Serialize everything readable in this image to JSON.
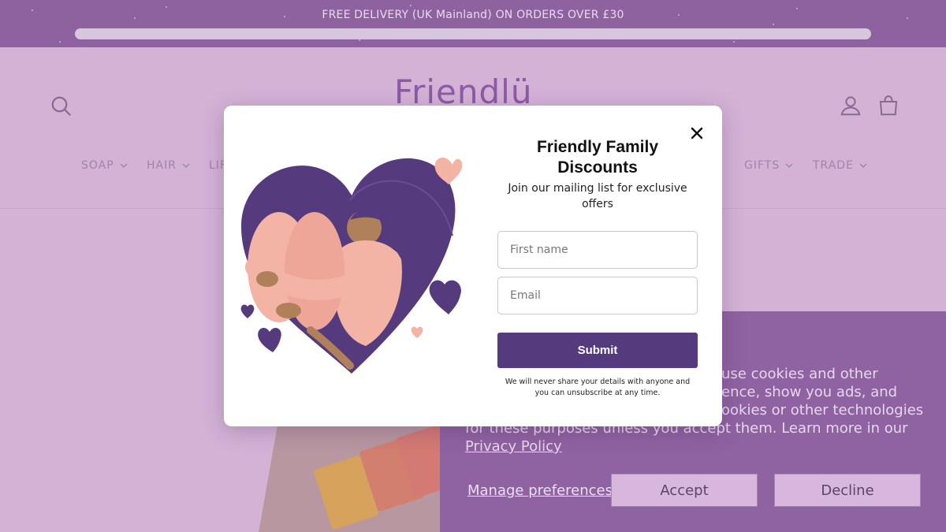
{
  "announcement": {
    "text": "FREE DELIVERY (UK Mainland) ON ORDERS OVER £30"
  },
  "header": {
    "logo_text": "Friendlü",
    "icons": [
      "search-icon",
      "account-icon",
      "cart-icon"
    ],
    "nav": [
      {
        "label": "SOAP"
      },
      {
        "label": "HAIR"
      },
      {
        "label": "LIF"
      },
      {
        "label": "GIFTS"
      },
      {
        "label": "TRADE"
      }
    ]
  },
  "modal": {
    "title": "Friendly Family Discounts",
    "subtitle": "Join our mailing list for exclusive offers",
    "first_name_placeholder": "First name",
    "email_placeholder": "Email",
    "submit_label": "Submit",
    "note": "We will never share your details with anyone and you can unsubscribe at any time."
  },
  "cookie_banner": {
    "text_line1": "use cookies and other",
    "text_line2": "ence, show you ads, and",
    "text_line3": "ookies or other technologies",
    "text_line4": "for these purposes unless you accept them. Learn more in our",
    "privacy_link": "Privacy Policy",
    "manage_label": "Manage preferences",
    "accept_label": "Accept",
    "decline_label": "Decline"
  },
  "colors": {
    "brand_purple": "#553b7e",
    "overlay_bar": "#8e629e",
    "page_bg": "#d3b2d6",
    "cookie_bg": "#8f62a1"
  }
}
